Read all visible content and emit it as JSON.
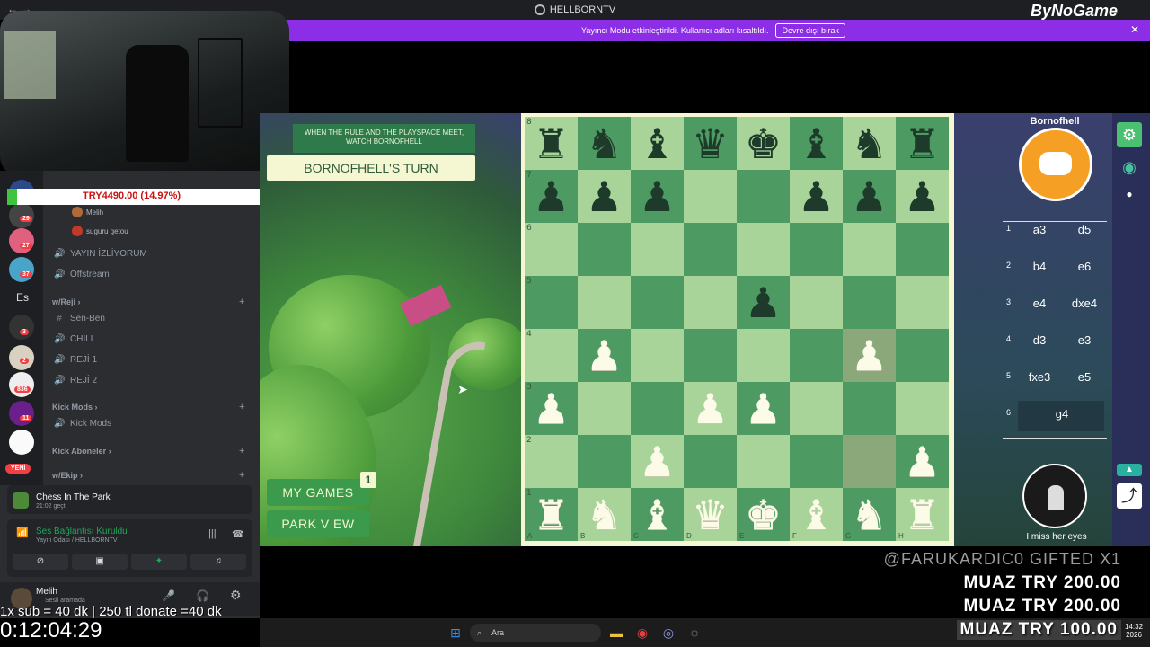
{
  "window": {
    "title": "HELLBORNTV",
    "brand": "ByNoGame"
  },
  "banner": {
    "text": "Yayıncı Modu etkinleştirildi. Kullanıcı adları kısaltıldı.",
    "button": "Devre dışı bırak"
  },
  "donation_bar": {
    "text": "TRY4490.00 (14.97%)",
    "percent": 14.97
  },
  "server_badges": [
    "29",
    "27",
    "37",
    "3",
    "2",
    "836",
    "11"
  ],
  "server_letters": "Es",
  "yeni_badge": "YENİ",
  "channels": {
    "members_top": [
      {
        "name": "Melih"
      },
      {
        "name": "suguru getou"
      }
    ],
    "voice1": "YAYIN İZLİYORUM",
    "voice2": "Offstream",
    "cat_reji": "w/Reji",
    "text_senben": "Sen-Ben",
    "v_chill": "CHILL",
    "v_reji1": "REJİ 1",
    "v_reji2": "REJİ 2",
    "cat_kickmods": "Kick Mods",
    "v_kickmods": "Kick Mods",
    "cat_kickaboneler": "Kick Aboneler",
    "cat_ekip": "w/Ekip"
  },
  "activity": {
    "title": "Chess In The Park",
    "time": "21:02 geçti"
  },
  "voice_status": {
    "title": "Ses Bağlantısı Kuruldu",
    "subtitle": "Yayın Odası / HELLBORNTV"
  },
  "user": {
    "name": "Melih",
    "status": "Sesli aramada"
  },
  "overlay": {
    "subline": "1x sub = 40 dk | 250 tl donate =40 dk",
    "timer": "0:12:04:29"
  },
  "game": {
    "tagline": "WHEN THE RULE AND THE PLAYSPACE MEET, WATCH BORNOFHELL",
    "turn": "BORNOFHELL'S TURN",
    "my_games": "MY GAMES",
    "my_games_count": "1",
    "park_view": "PARK V EW"
  },
  "board": {
    "ranks": [
      "8",
      "7",
      "6",
      "5",
      "4",
      "3",
      "2",
      "1"
    ],
    "files": [
      "A",
      "B",
      "C",
      "D",
      "E",
      "F",
      "G",
      "H"
    ],
    "rows": [
      [
        "bR",
        "bN",
        "bB",
        "bQ",
        "bK",
        "bB",
        "bN",
        "bR"
      ],
      [
        "bP",
        "bP",
        "bP",
        "",
        "",
        "bP",
        "bP",
        "bP"
      ],
      [
        "",
        "",
        "",
        "",
        "",
        "",
        "",
        ""
      ],
      [
        "",
        "",
        "",
        "",
        "bP",
        "",
        "",
        ""
      ],
      [
        "",
        "wP",
        "",
        "",
        "",
        "",
        "wP",
        ""
      ],
      [
        "wP",
        "",
        "",
        "wP",
        "wP",
        "",
        "",
        ""
      ],
      [
        "",
        "",
        "wP",
        "",
        "",
        "",
        "",
        "wP"
      ],
      [
        "wR",
        "wN",
        "wB",
        "wQ",
        "wK",
        "wB",
        "wN",
        "wR"
      ]
    ],
    "highlight": [
      "4-6",
      "6-6"
    ]
  },
  "opponent": {
    "name": "Bornofhell",
    "caption": "I miss her eyes"
  },
  "moves": [
    {
      "n": "1",
      "w": "a3",
      "b": "d5"
    },
    {
      "n": "2",
      "w": "b4",
      "b": "e6"
    },
    {
      "n": "3",
      "w": "e4",
      "b": "dxe4"
    },
    {
      "n": "4",
      "w": "d3",
      "b": "e3"
    },
    {
      "n": "5",
      "w": "fxe3",
      "b": "e5"
    },
    {
      "n": "6",
      "w": "g4",
      "b": ""
    }
  ],
  "donations": {
    "gifted": "@FARUKARDIC0 GIFTED X1",
    "list": [
      "MUAZ  TRY 200.00",
      "MUAZ  TRY 200.00",
      "MUAZ  TRY 100.00"
    ]
  },
  "taskbar": {
    "search": "Ara",
    "time": "14:32",
    "date": "2026"
  },
  "icons": {
    "gear": "⚙",
    "eye": "👁",
    "share": "⤴",
    "arrow_up": "▲"
  },
  "colors": {
    "accent_banner": "#8b2ee6",
    "board_light": "#a8d49a",
    "board_dark": "#4d9a62"
  }
}
